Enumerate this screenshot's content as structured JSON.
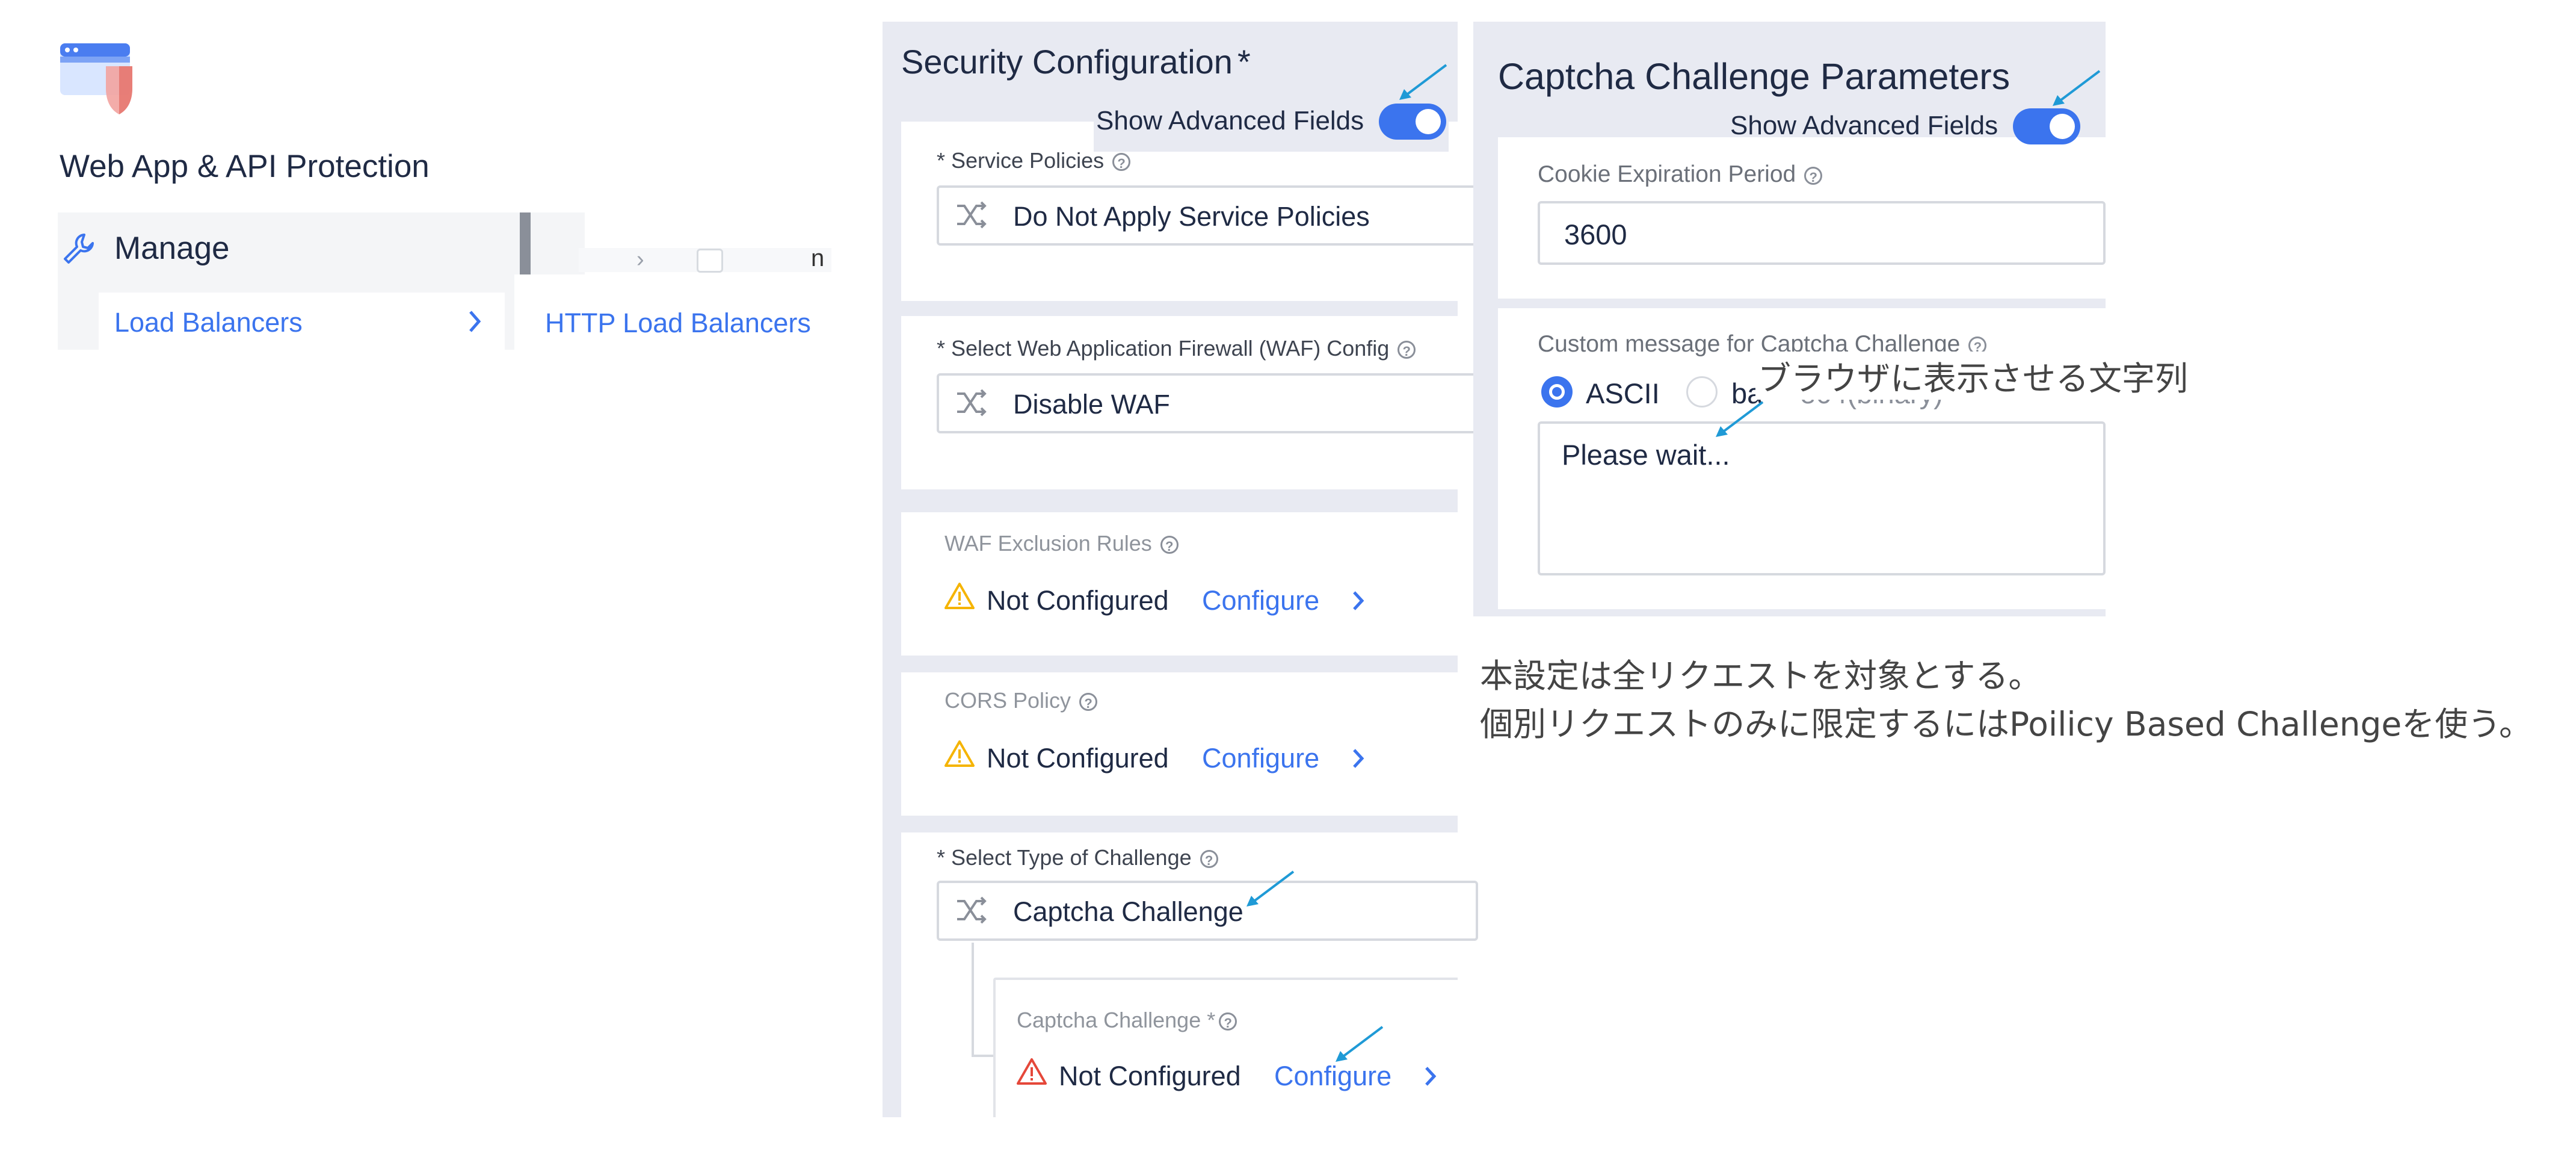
{
  "app": {
    "title": "Web App & API Protection",
    "icon": "waap-logo-icon"
  },
  "nav": {
    "section_label": "Manage",
    "section_icon": "wrench-icon",
    "item_label": "Load Balancers",
    "submenu_label": "HTTP Load Balancers",
    "background_letter": "n"
  },
  "security": {
    "title": "Security Configuration",
    "required_mark": "*",
    "show_advanced_label": "Show Advanced Fields",
    "show_advanced_on": true,
    "service_policies": {
      "label": "* Service Policies",
      "value": "Do Not Apply Service Policies"
    },
    "waf": {
      "label": "* Select Web Application Firewall (WAF) Config",
      "value": "Disable WAF"
    },
    "waf_exclusion": {
      "label": "WAF Exclusion Rules",
      "status": "Not Configured",
      "action": "Configure"
    },
    "cors": {
      "label": "CORS Policy",
      "status": "Not Configured",
      "action": "Configure"
    },
    "challenge_type": {
      "label": "* Select Type of Challenge",
      "value": "Captcha Challenge"
    },
    "captcha_challenge": {
      "label": "Captcha Challenge *",
      "status": "Not Configured",
      "action": "Configure"
    }
  },
  "captcha": {
    "title": "Captcha Challenge Parameters",
    "show_advanced_label": "Show Advanced Fields",
    "show_advanced_on": true,
    "cookie_expiration": {
      "label": "Cookie Expiration Period",
      "value": "3600"
    },
    "custom_message": {
      "label": "Custom message for Captcha Challenge",
      "encoding_options": [
        "ASCII",
        "base64(binary)"
      ],
      "encoding_visible": [
        "ASCII",
        "ba",
        "e64(binary)"
      ],
      "selected": "ASCII",
      "value": "Please wait..."
    }
  },
  "annotations": {
    "browser_text": "ブラウザに表示させる文字列",
    "note_line1": "本設定は全リクエストを対象とする。",
    "note_line2": "個別リクエストのみに限定するにはPoilicy Based Challengeを使う。"
  },
  "colors": {
    "accent": "#3b74ee",
    "warning": "#f5b400",
    "error": "#e5483a",
    "annotation_arrow": "#1f9ad6",
    "panel_bg": "#e8eaf2"
  }
}
